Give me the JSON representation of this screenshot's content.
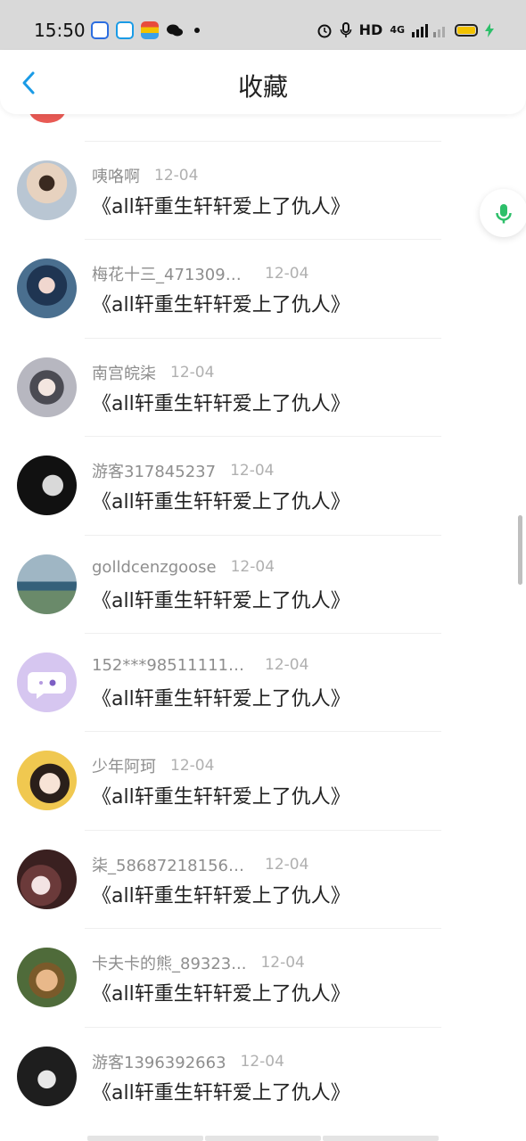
{
  "status_bar": {
    "time": "15:50",
    "network_label": "HD",
    "signal_label": "4G",
    "battery_color": "#f2c200",
    "icons": [
      "baidu-app-icon",
      "browser-app-icon",
      "colorful-app-icon",
      "wechat-icon",
      "alarm-icon",
      "mic-icon",
      "signal-icon",
      "battery-icon"
    ]
  },
  "header": {
    "title": "收藏"
  },
  "items": [
    {
      "name": "咦咯啊",
      "date": "12-04",
      "text": "《all轩重生轩轩爱上了仇人》",
      "avatar_color": "#c9b8a8"
    },
    {
      "name": "梅花十三_4713094...",
      "date": "12-04",
      "text": "《all轩重生轩轩爱上了仇人》",
      "avatar_color": "#4a6f8f"
    },
    {
      "name": "南宫皖柒",
      "date": "12-04",
      "text": "《all轩重生轩轩爱上了仇人》",
      "avatar_color": "#9a9aa4"
    },
    {
      "name": "游客317845237",
      "date": "12-04",
      "text": "《all轩重生轩轩爱上了仇人》",
      "avatar_color": "#2b2b2b"
    },
    {
      "name": "golldcenzgoose",
      "date": "12-04",
      "text": "《all轩重生轩轩爱上了仇人》",
      "avatar_color": "#6f8fa3"
    },
    {
      "name": "152***985111111...",
      "date": "12-04",
      "text": "《all轩重生轩轩爱上了仇人》",
      "avatar_color": "#d6c6f0"
    },
    {
      "name": "少年阿珂",
      "date": "12-04",
      "text": "《all轩重生轩轩爱上了仇人》",
      "avatar_color": "#e0b860"
    },
    {
      "name": "柒_586872181565...",
      "date": "12-04",
      "text": "《all轩重生轩轩爱上了仇人》",
      "avatar_color": "#5a3a3a"
    },
    {
      "name": "卡夫卡的熊_89323...",
      "date": "12-04",
      "text": "《all轩重生轩轩爱上了仇人》",
      "avatar_color": "#4f6b3a"
    },
    {
      "name": "游客1396392663",
      "date": "12-04",
      "text": "《all轩重生轩轩爱上了仇人》",
      "avatar_color": "#3a3a3a"
    }
  ],
  "accent_color": "#1a9be6",
  "mic_color": "#2dbf6a"
}
